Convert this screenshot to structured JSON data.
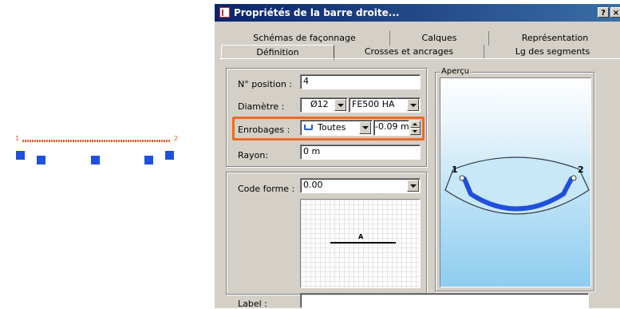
{
  "canvas": {
    "end_left_label": "1",
    "end_right_label": "2"
  },
  "dialog": {
    "title": "Propriétés de la barre droite...",
    "help_button": "?",
    "close_button": "×",
    "tabs_row1": [
      "Schémas de façonnage",
      "Calques",
      "Représentation"
    ],
    "tabs_row2": [
      "Définition",
      "Crosses et ancrages",
      "Lg des segments"
    ],
    "active_tab": "Définition",
    "fields": {
      "position_label": "N° position :",
      "position_value": "4",
      "diametre_label": "Diamètre :",
      "diametre_value": "Ø12",
      "acier_value": "FE500 HA",
      "enrobages_label": "Enrobages :",
      "enrobages_value": "Toutes",
      "enrobages_offset": "-0.09 m",
      "rayon_label": "Rayon:",
      "rayon_value": "0 m",
      "code_forme_label": "Code forme :",
      "code_forme_value": "0.00",
      "shape_segment_label": "A",
      "label_label": "Label :",
      "label_value": ""
    },
    "preview": {
      "title": "Aperçu",
      "end1": "1",
      "end2": "2"
    },
    "highlight_color": "#ef6a1f",
    "bar_color": "#1f4fdc"
  }
}
